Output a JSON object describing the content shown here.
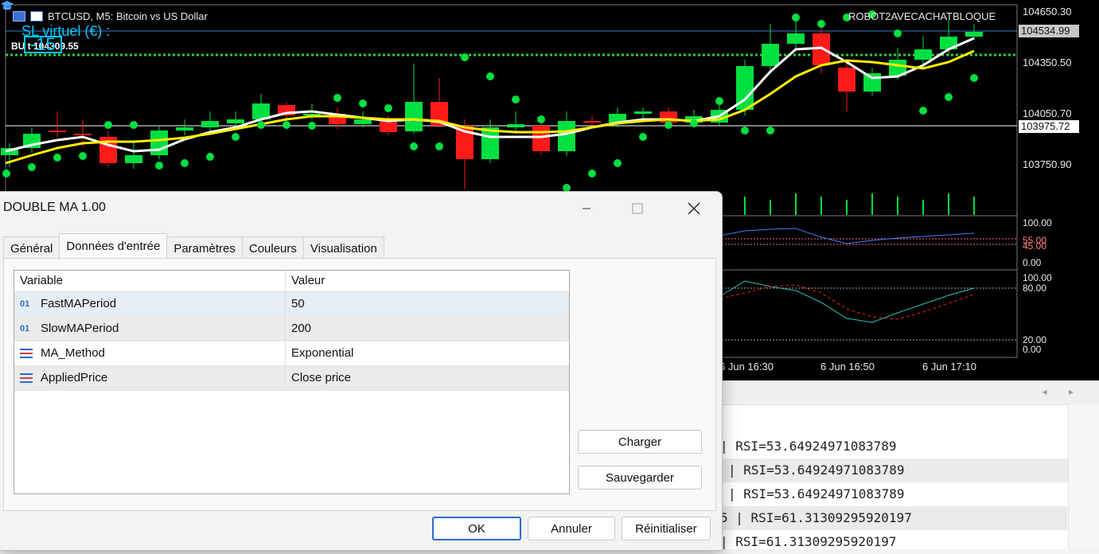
{
  "chart": {
    "title": "BTCUSD, M5:  Bitcoin vs US Dollar",
    "ea_name": "ROBOT2AVECACHATBLOQUE",
    "sl_label": "SL virtuel (€) :",
    "sl_value": "-15",
    "price_line_label": "BU      t 104309.55",
    "price_axis": [
      "104650.30",
      "104350.50",
      "104050.70",
      "103750.90"
    ],
    "current_price": "104534.99",
    "line_price": "103975.72",
    "rsi_axis": [
      "100.00",
      "55.00",
      "45.00",
      "0.00"
    ],
    "stoch_axis": [
      "100.00",
      "80.00",
      "20.00",
      "0.00"
    ],
    "time_labels": [
      "6 Jun 16:30",
      "6 Jun 16:50",
      "6 Jun 17:10"
    ],
    "colors": {
      "background": "#000000",
      "bull": "#00e040",
      "bear": "#ff1a1a",
      "fast_ma": "#ffffff",
      "slow_ma": "#ffee00",
      "sar": "#00e040",
      "rsi": "#3f7fff",
      "stoch_main": "#2ec4b6",
      "stoch_signal": "#e02020"
    }
  },
  "dialog": {
    "title": "DOUBLE MA 1.00",
    "tabs": [
      "Général",
      "Données d'entrée",
      "Paramètres",
      "Couleurs",
      "Visualisation"
    ],
    "active_tab": "Données d'entrée",
    "columns": [
      "Variable",
      "Valeur"
    ],
    "rows": [
      {
        "icon": "int-icon",
        "icon_text": "01",
        "variable": "FastMAPeriod",
        "value": "50"
      },
      {
        "icon": "int-icon",
        "icon_text": "01",
        "variable": "SlowMAPeriod",
        "value": "200"
      },
      {
        "icon": "enum-icon",
        "icon_text": "",
        "variable": "MA_Method",
        "value": "Exponential"
      },
      {
        "icon": "enum-icon",
        "icon_text": "",
        "variable": "AppliedPrice",
        "value": "Close price"
      }
    ],
    "buttons": {
      "load": "Charger",
      "save": "Sauvegarder",
      "ok": "OK",
      "cancel": "Annuler",
      "reset": "Réinitialiser"
    }
  },
  "log": {
    "rows": [
      "| RSI=53.64924971083789",
      "| RSI=53.64924971083789",
      "| RSI=53.64924971083789",
      "5 | RSI=61.31309295920197",
      "| RSI=61.31309295920197"
    ]
  }
}
